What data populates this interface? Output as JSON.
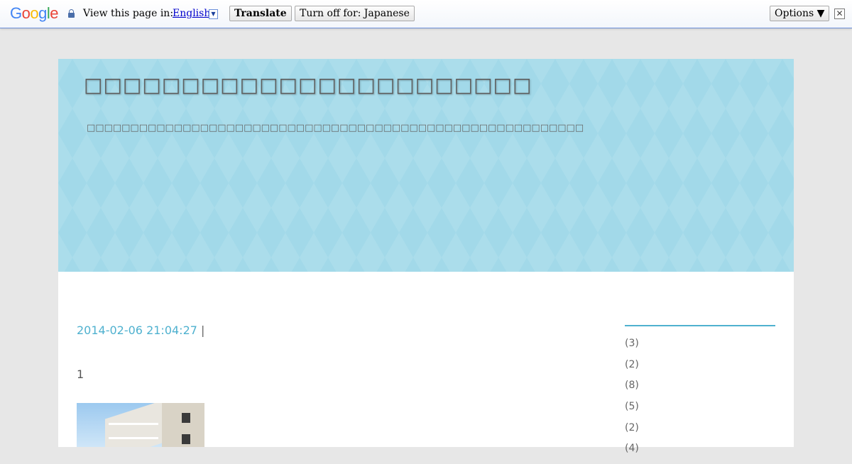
{
  "translate_bar": {
    "logo": "Google",
    "view_label": "View this page in:",
    "language": "English",
    "translate_button": "Translate",
    "turn_off_button": "Turn off for: Japanese",
    "options_button": "Options ▼",
    "close_glyph": "✕"
  },
  "blog": {
    "title": "□□□□□□□□□□□□□□□□□□□□□□□",
    "description": "□□□□□□□□□□□□□□□□□□□□□□□□□□□□□□□□□□□□□□□□□□□□□□□□□□□□□□□□□"
  },
  "post": {
    "date": "2014-02-06 21:04:27",
    "separator": "|",
    "body": "1"
  },
  "sidebar": {
    "counts": [
      "(3)",
      "(2)",
      "(8)",
      "(5)",
      "(2)",
      "(4)"
    ]
  },
  "colors": {
    "header_bg": "#a2d9e9",
    "accent": "#4fb1cf",
    "page_bg": "#e7e7e7"
  }
}
